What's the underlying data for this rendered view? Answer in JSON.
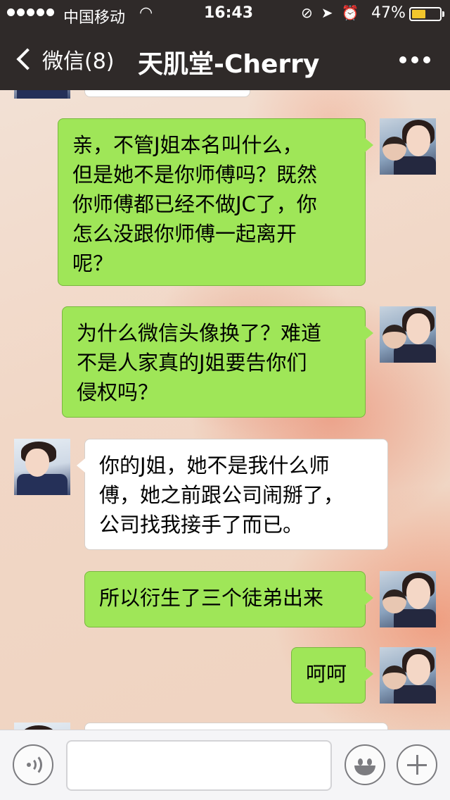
{
  "status_bar": {
    "carrier": "中国移动",
    "time": "16:43",
    "battery_percent": "47%",
    "battery_level": 0.47,
    "icons": [
      "signal-dots-icon",
      "wifi-icon",
      "rotation-lock-icon",
      "location-arrow-icon",
      "alarm-icon",
      "battery-icon"
    ]
  },
  "nav": {
    "back_label": "微信(8)",
    "title": "天肌堂-Cherry",
    "more_icon": "ellipsis-icon"
  },
  "messages": [
    {
      "side": "out",
      "text": "亲，不管J姐本名叫什么，\n但是她不是你师傅吗？既然\n你师傅都已经不做JC了，你\n怎么没跟你师傅一起离开\n呢？"
    },
    {
      "side": "out",
      "text": "为什么微信头像换了？难道\n不是人家真的J姐要告你们\n侵权吗？"
    },
    {
      "side": "in",
      "text": "你的J姐，她不是我什么师\n傅，她之前跟公司闹掰了，\n公司找我接手了而已。"
    },
    {
      "side": "out",
      "text": "所以衍生了三个徒弟出来"
    },
    {
      "side": "out",
      "text": "呵呵"
    }
  ],
  "input_bar": {
    "voice_icon": "voice-icon",
    "input_value": "",
    "emoji_icon": "emoji-icon",
    "plus_icon": "plus-icon"
  },
  "colors": {
    "nav_bg": "#2f2a29",
    "outgoing_bubble": "#9fe658",
    "incoming_bubble": "#ffffff",
    "battery_fill": "#f2c62c"
  }
}
